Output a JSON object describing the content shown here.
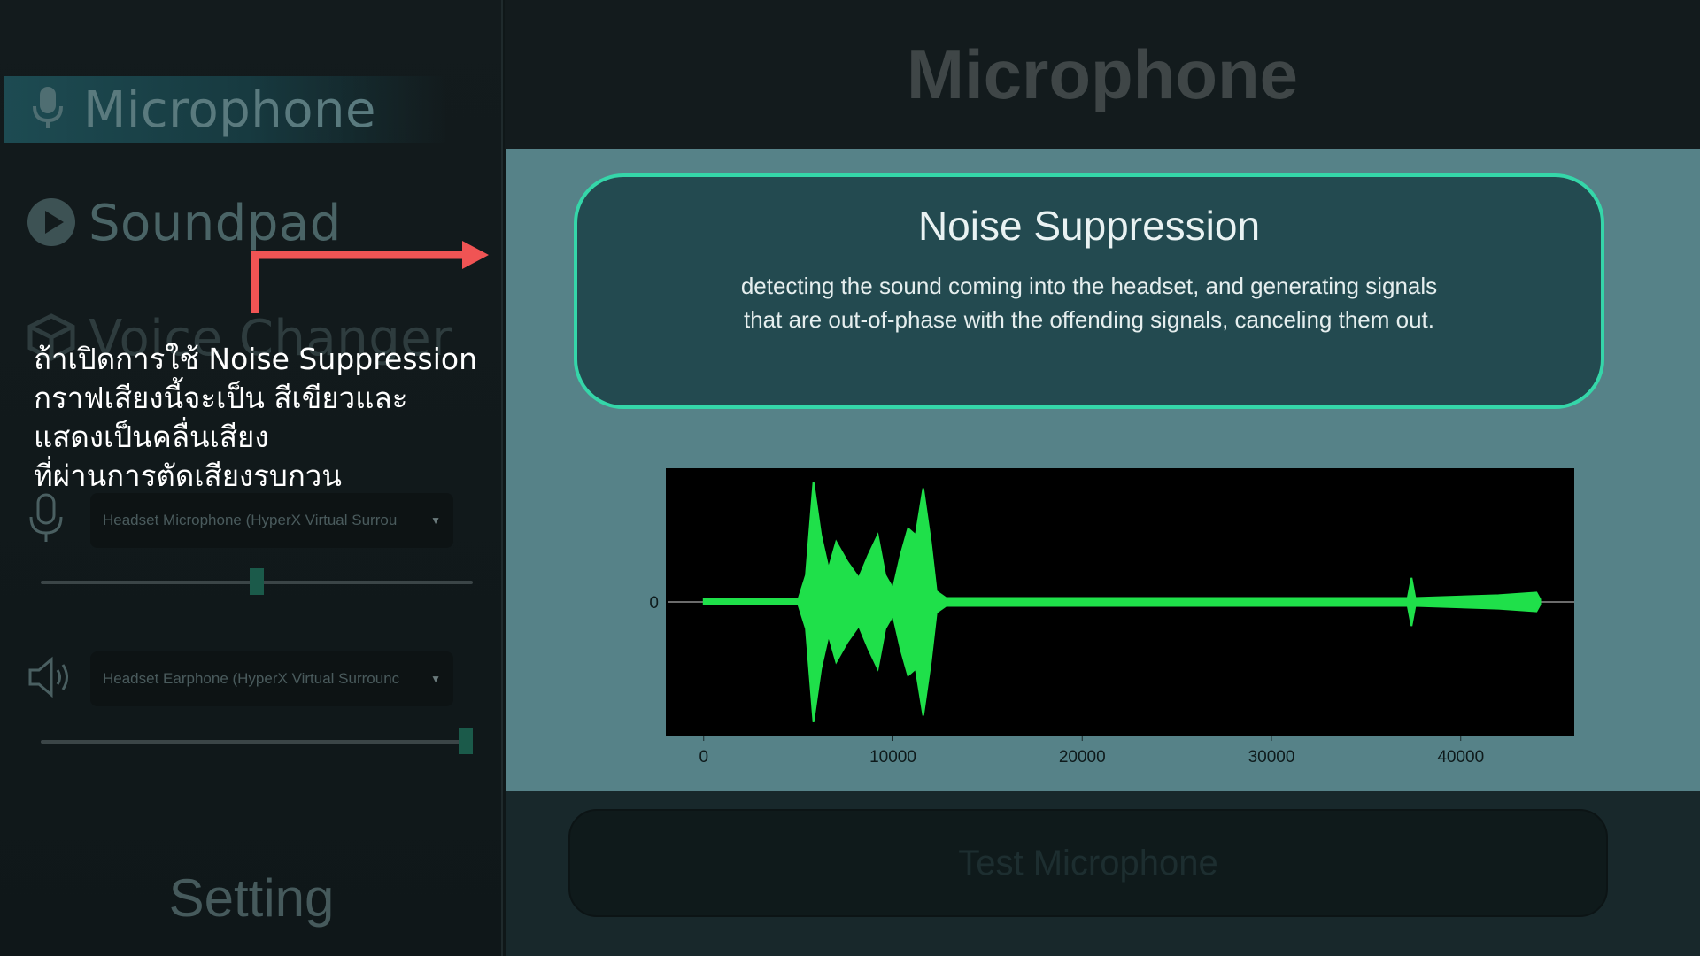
{
  "sidebar": {
    "items": [
      {
        "label": "Microphone",
        "icon": "microphone-icon",
        "active": true
      },
      {
        "label": "Soundpad",
        "icon": "play-icon",
        "active": false
      },
      {
        "label": "Voice Changer",
        "icon": "cube-icon",
        "active": false
      }
    ],
    "input_device": {
      "value": "Headset Microphone (HyperX Virtual Surrou",
      "icon": "microphone-outline-icon",
      "volume": 0.5
    },
    "output_device": {
      "value": "Headset Earphone (HyperX Virtual Surrounc",
      "icon": "speaker-icon",
      "volume": 1.0
    },
    "setting_label": "Setting"
  },
  "annotation": {
    "lines": [
      "ถ้าเปิดการใช้ Noise Suppression",
      "กราฟเสียงนี้จะเป็น สีเขียวและ",
      "แสดงเป็นคลื่นเสียง",
      "ที่ผ่านการตัดเสียงรบกวน"
    ],
    "arrow_color": "#f05454"
  },
  "main": {
    "title": "Microphone",
    "noise_suppression": {
      "title": "Noise Suppression",
      "description_line1": "detecting the sound coming into the headset, and generating signals",
      "description_line2": "that are  out-of-phase with the  offending signals, canceling them out."
    },
    "test_button_label": "Test Microphone"
  },
  "colors": {
    "accent": "#35d6a9",
    "wave": "#1fe04a",
    "panel": "#568288"
  },
  "chart_data": {
    "type": "line",
    "title": "",
    "xlabel": "",
    "ylabel": "",
    "xlim": [
      -2000,
      46000
    ],
    "ylim": [
      -1,
      1
    ],
    "x_ticks": [
      0,
      10000,
      20000,
      30000,
      40000
    ],
    "x_tick_labels": [
      "0",
      "10000",
      "20000",
      "30000",
      "40000"
    ],
    "y_ticks": [
      0
    ],
    "y_tick_labels": [
      "0"
    ],
    "series": [
      {
        "color": "#1fe04a",
        "envelope": [
          {
            "x": 0,
            "amp": 0.02
          },
          {
            "x": 5000,
            "amp": 0.02
          },
          {
            "x": 5400,
            "amp": 0.2
          },
          {
            "x": 5800,
            "amp": 0.9
          },
          {
            "x": 6200,
            "amp": 0.5
          },
          {
            "x": 6600,
            "amp": 0.25
          },
          {
            "x": 7000,
            "amp": 0.45
          },
          {
            "x": 7600,
            "amp": 0.3
          },
          {
            "x": 8200,
            "amp": 0.18
          },
          {
            "x": 8700,
            "amp": 0.35
          },
          {
            "x": 9200,
            "amp": 0.5
          },
          {
            "x": 9600,
            "amp": 0.2
          },
          {
            "x": 10000,
            "amp": 0.1
          },
          {
            "x": 10400,
            "amp": 0.35
          },
          {
            "x": 10800,
            "amp": 0.55
          },
          {
            "x": 11200,
            "amp": 0.5
          },
          {
            "x": 11600,
            "amp": 0.85
          },
          {
            "x": 12000,
            "amp": 0.45
          },
          {
            "x": 12300,
            "amp": 0.08
          },
          {
            "x": 12800,
            "amp": 0.03
          },
          {
            "x": 20000,
            "amp": 0.03
          },
          {
            "x": 30000,
            "amp": 0.03
          },
          {
            "x": 37200,
            "amp": 0.03
          },
          {
            "x": 37400,
            "amp": 0.18
          },
          {
            "x": 37600,
            "amp": 0.03
          },
          {
            "x": 42000,
            "amp": 0.05
          },
          {
            "x": 44000,
            "amp": 0.07
          },
          {
            "x": 44200,
            "amp": 0.02
          }
        ]
      }
    ]
  }
}
